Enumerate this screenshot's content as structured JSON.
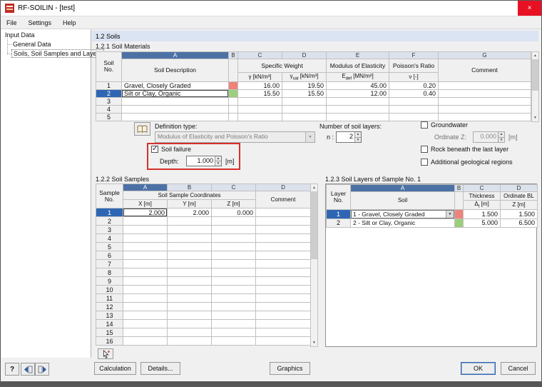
{
  "window": {
    "title": "RF-SOILIN - [test]",
    "close": "×"
  },
  "menu": [
    "File",
    "Settings",
    "Help"
  ],
  "tree": {
    "root": "Input Data",
    "children": [
      "General Data",
      "Soils, Soil Samples and Layers"
    ]
  },
  "main": {
    "header": "1.2 Soils"
  },
  "materials": {
    "title": "1.2.1 Soil Materials",
    "letters": [
      "A",
      "B",
      "C",
      "D",
      "E",
      "F",
      "G"
    ],
    "corner1": "Soil",
    "corner2": "No.",
    "h_description": "Soil Description",
    "h_specific_weight": "Specific Weight",
    "h_gamma": "γ [kN/m³]",
    "h_gsat_base": "γ",
    "h_gsat_sub": "sat",
    "h_gsat_unit": " [kN/m³]",
    "h_modulus": "Modulus of Elasticity",
    "h_edef_base": "E",
    "h_edef_sub": "def",
    "h_edef_unit": " [MN/m²]",
    "h_poisson": "Poisson's Ratio",
    "h_nu": "ν [-]",
    "h_comment": "Comment",
    "rows": [
      {
        "no": "1",
        "description": "Gravel, Closely Graded",
        "color": "#ef837b",
        "gamma": "16.00",
        "gamma_sat": "19.50",
        "edef": "45.00",
        "nu": "0.20",
        "comment": "",
        "selected": false
      },
      {
        "no": "2",
        "description": "Silt or Clay, Organic",
        "color": "#9cce7c",
        "gamma": "15.50",
        "gamma_sat": "15.50",
        "edef": "12.00",
        "nu": "0.40",
        "comment": "",
        "selected": true
      },
      {
        "no": "3",
        "description": "",
        "color": "",
        "gamma": "",
        "gamma_sat": "",
        "edef": "",
        "nu": "",
        "comment": "",
        "selected": false
      },
      {
        "no": "4",
        "description": "",
        "color": "",
        "gamma": "",
        "gamma_sat": "",
        "edef": "",
        "nu": "",
        "comment": "",
        "selected": false
      },
      {
        "no": "5",
        "description": "",
        "color": "",
        "gamma": "",
        "gamma_sat": "",
        "edef": "",
        "nu": "",
        "comment": "",
        "selected": false
      }
    ]
  },
  "controls": {
    "definition_label": "Definition type:",
    "definition_value": "Modulus of Elasticity and Poisson's Ratio",
    "layers_count_label": "Number of soil layers:",
    "n_label": "n :",
    "n_value": "2",
    "groundwater": "Groundwater",
    "ordinate_label": "Ordinate Z:",
    "ordinate_value": "0.000",
    "unit_m": "[m]",
    "rock": "Rock beneath the last layer",
    "regions": "Additional geological regions",
    "soil_failure": "Soil failure",
    "depth_label": "Depth:",
    "depth_value": "1.000"
  },
  "samples": {
    "title": "1.2.2 Soil Samples",
    "letters": [
      "A",
      "B",
      "C",
      "D"
    ],
    "corner1": "Sample",
    "corner2": "No.",
    "h_coords": "Soil Sample Coordinates",
    "h_x": "X [m]",
    "h_y": "Y [m]",
    "h_z": "Z [m]",
    "h_comment": "Comment",
    "rows": [
      {
        "no": "1",
        "x": "2.000",
        "y": "2.000",
        "z": "0.000",
        "comment": "",
        "selected": true
      },
      {
        "no": "2",
        "x": "",
        "y": "",
        "z": "",
        "comment": "",
        "selected": false
      },
      {
        "no": "3",
        "x": "",
        "y": "",
        "z": "",
        "comment": "",
        "selected": false
      },
      {
        "no": "4",
        "x": "",
        "y": "",
        "z": "",
        "comment": "",
        "selected": false
      },
      {
        "no": "5",
        "x": "",
        "y": "",
        "z": "",
        "comment": "",
        "selected": false
      },
      {
        "no": "6",
        "x": "",
        "y": "",
        "z": "",
        "comment": "",
        "selected": false
      },
      {
        "no": "7",
        "x": "",
        "y": "",
        "z": "",
        "comment": "",
        "selected": false
      },
      {
        "no": "8",
        "x": "",
        "y": "",
        "z": "",
        "comment": "",
        "selected": false
      },
      {
        "no": "9",
        "x": "",
        "y": "",
        "z": "",
        "comment": "",
        "selected": false
      },
      {
        "no": "10",
        "x": "",
        "y": "",
        "z": "",
        "comment": "",
        "selected": false
      },
      {
        "no": "11",
        "x": "",
        "y": "",
        "z": "",
        "comment": "",
        "selected": false
      },
      {
        "no": "12",
        "x": "",
        "y": "",
        "z": "",
        "comment": "",
        "selected": false
      },
      {
        "no": "13",
        "x": "",
        "y": "",
        "z": "",
        "comment": "",
        "selected": false
      },
      {
        "no": "14",
        "x": "",
        "y": "",
        "z": "",
        "comment": "",
        "selected": false
      },
      {
        "no": "15",
        "x": "",
        "y": "",
        "z": "",
        "comment": "",
        "selected": false
      },
      {
        "no": "16",
        "x": "",
        "y": "",
        "z": "",
        "comment": "",
        "selected": false
      }
    ]
  },
  "layers": {
    "title": "1.2.3 Soil Layers of Sample No. 1",
    "letters": [
      "A",
      "B",
      "C",
      "D"
    ],
    "corner1": "Layer",
    "corner2": "No.",
    "h_soil": "Soil",
    "h_thickness": "Thickness",
    "h_dt_base": "Δ",
    "h_dt_sub": "t",
    "h_dt_unit": " [m]",
    "h_ordinate": "Ordinate BL",
    "h_z": "Z [m]",
    "rows": [
      {
        "no": "1",
        "soil": "1 - Gravel, Closely Graded",
        "color": "#ef837b",
        "dt": "1.500",
        "z": "1.500",
        "selected": true,
        "combo": true
      },
      {
        "no": "2",
        "soil": "2 - Silt or Clay, Organic",
        "color": "#9cce7c",
        "dt": "5.000",
        "z": "6.500",
        "selected": false,
        "combo": false
      }
    ]
  },
  "footer": {
    "help": "?",
    "calculation": "Calculation",
    "details": "Details...",
    "graphics": "Graphics",
    "ok": "OK",
    "cancel": "Cancel"
  }
}
